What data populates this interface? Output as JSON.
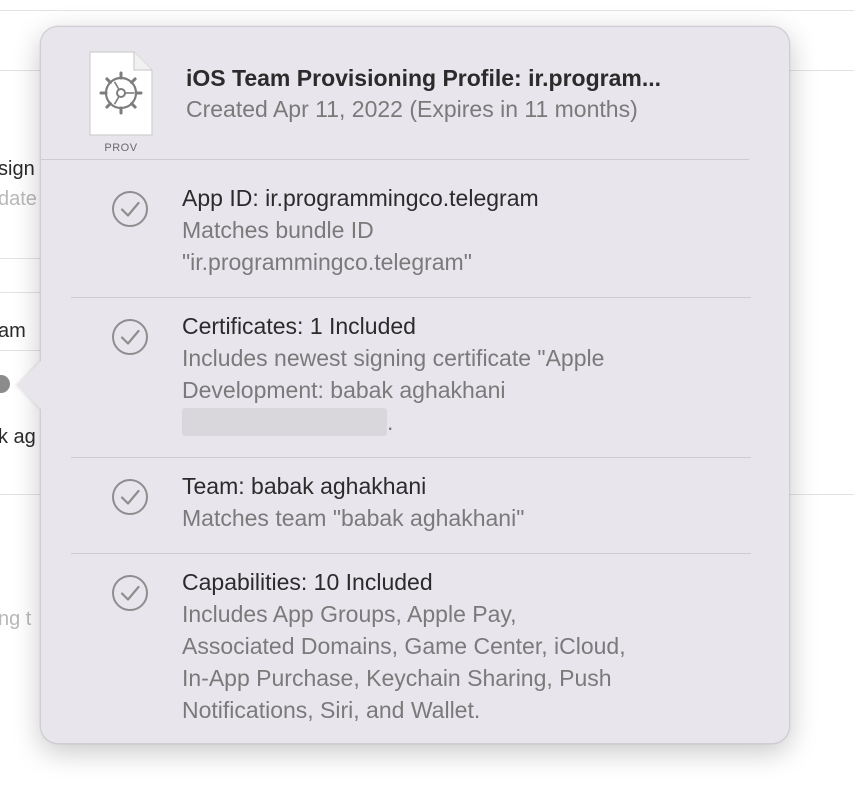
{
  "background": {
    "fragments": [
      "sign",
      "date",
      "am",
      "k ag",
      "ng t"
    ]
  },
  "popover": {
    "file_icon": {
      "name": "gear-icon",
      "label": "PROV"
    },
    "title": "iOS Team Provisioning Profile: ir.program...",
    "subtitle": "Created Apr 11, 2022 (Expires in 11 months)",
    "sections": [
      {
        "icon": "check-circle-icon",
        "title": "App ID: ir.programmingco.telegram",
        "desc_lines": [
          "Matches bundle ID",
          "\"ir.programmingco.telegram\""
        ]
      },
      {
        "icon": "check-circle-icon",
        "title": "Certificates: 1 Included",
        "desc_lines": [
          "Includes newest signing certificate \"Apple",
          "Development: babak aghakhani"
        ],
        "desc_tail": "."
      },
      {
        "icon": "check-circle-icon",
        "title": "Team: babak aghakhani",
        "desc_lines": [
          "Matches team \"babak aghakhani\""
        ]
      },
      {
        "icon": "check-circle-icon",
        "title": "Capabilities: 10 Included",
        "desc_lines": [
          "Includes App Groups, Apple Pay,",
          "Associated Domains, Game Center, iCloud,",
          "In-App Purchase, Keychain Sharing, Push",
          "Notifications, Siri, and Wallet."
        ]
      }
    ]
  },
  "colors": {
    "popover_bg": "#e8e5ec",
    "title_text": "#2b2b2b",
    "secondary_text": "#7a7a7a",
    "check_icon": "#8e8e8e"
  }
}
